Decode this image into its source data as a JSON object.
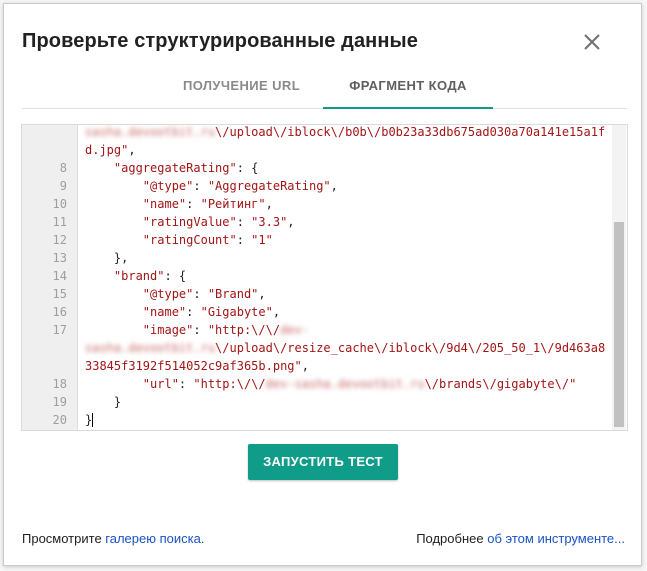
{
  "dialog": {
    "title": "Проверьте структурированные данные",
    "close_icon": "close-icon"
  },
  "tabs": [
    {
      "label": "ПОЛУЧЕНИЕ URL",
      "active": false
    },
    {
      "label": "ФРАГМЕНТ КОДА",
      "active": true
    }
  ],
  "code": {
    "line_numbers": [
      "",
      "",
      "8",
      "9",
      "10",
      "11",
      "12",
      "13",
      "14",
      "15",
      "16",
      "17",
      "",
      "",
      "18",
      "19",
      "20"
    ],
    "lines": [
      {
        "pre": "",
        "blur": "sasha.devootbit.ru",
        "post": "\\/upload\\/iblock\\/b0b\\/b0b23a33db675ad030a70a141e15a1f"
      },
      {
        "pre": "d.jpg\",",
        "blur": "",
        "post": ""
      },
      {
        "pre": "    \"aggregateRating\": {",
        "blur": "",
        "post": ""
      },
      {
        "pre": "        \"@type\": \"AggregateRating\",",
        "blur": "",
        "post": ""
      },
      {
        "pre": "        \"name\": \"Рейтинг\",",
        "blur": "",
        "post": ""
      },
      {
        "pre": "        \"ratingValue\": \"3.3\",",
        "blur": "",
        "post": ""
      },
      {
        "pre": "        \"ratingCount\": \"1\"",
        "blur": "",
        "post": ""
      },
      {
        "pre": "    },",
        "blur": "",
        "post": ""
      },
      {
        "pre": "    \"brand\": {",
        "blur": "",
        "post": ""
      },
      {
        "pre": "        \"@type\": \"Brand\",",
        "blur": "",
        "post": ""
      },
      {
        "pre": "        \"name\": \"Gigabyte\",",
        "blur": "",
        "post": ""
      },
      {
        "pre": "        \"image\": \"http:\\/\\/",
        "blur": "dev-",
        "post": ""
      },
      {
        "pre": "",
        "blur": "sasha.devootbit.ru",
        "post": "\\/upload\\/resize_cache\\/iblock\\/9d4\\/205_50_1\\/9d463a8"
      },
      {
        "pre": "33845f3192f514052c9af365b.png\",",
        "blur": "",
        "post": ""
      },
      {
        "pre": "        \"url\": \"http:\\/\\/",
        "blur": "dev-sasha.devootbit.ru",
        "post": "\\/brands\\/gigabyte\\/\""
      },
      {
        "pre": "    }",
        "blur": "",
        "post": ""
      },
      {
        "pre": "}",
        "blur": "",
        "post": ""
      }
    ]
  },
  "run_button": {
    "label": "ЗАПУСТИТЬ ТЕСТ"
  },
  "footer": {
    "left_text": "Просмотрите ",
    "left_link": "галерею поиска.",
    "right_text": "Подробнее ",
    "right_link": "об этом инструменте..."
  },
  "colors": {
    "accent": "#0f9d8a",
    "link": "#1a52c4",
    "string": "#a31515"
  }
}
